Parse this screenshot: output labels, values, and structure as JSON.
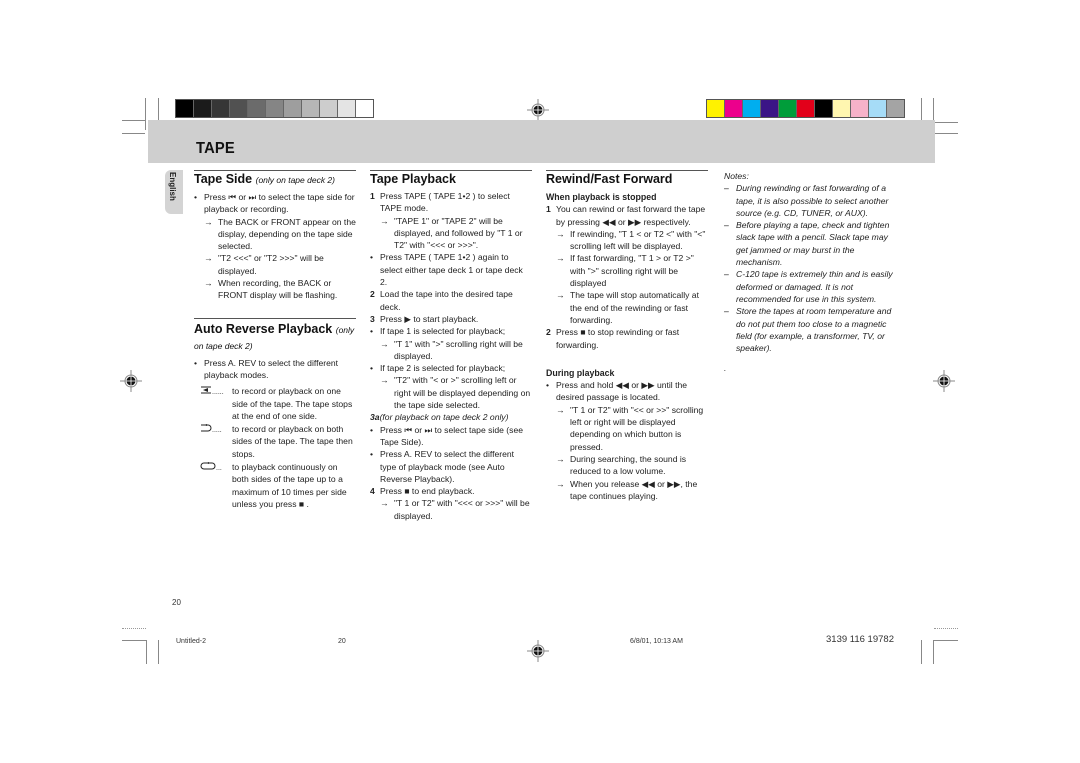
{
  "header": {
    "section_title": "TAPE",
    "language_tab": "English",
    "gray_swatches": [
      "#000000",
      "#1b1b1b",
      "#363636",
      "#515151",
      "#6b6b6b",
      "#858585",
      "#9e9e9e",
      "#b6b6b6",
      "#cdcdcd",
      "#e4e4e4",
      "#ffffff"
    ],
    "color_swatches": [
      "#fff200",
      "#ec008c",
      "#00aeef",
      "#3b1586",
      "#009d3a",
      "#e2001a",
      "#000000",
      "#fff6b0",
      "#f6b2c9",
      "#a6dcf7",
      "#a4a4a4"
    ]
  },
  "col1": {
    "tape_side": {
      "title": "Tape Side",
      "note": "(only on tape deck 2)",
      "items": [
        {
          "m": "•",
          "t": "Press ⏮ or ⏭ to select the tape side for playback or recording."
        },
        {
          "m": "→",
          "t": "The BACK or FRONT appear on the display, depending on the tape side selected.",
          "sub": true
        },
        {
          "m": "→",
          "t": "\"T2  <<<\" or \"T2  >>>\" will be displayed.",
          "sub": true
        },
        {
          "m": "→",
          "t": "When recording, the BACK or FRONT display will be flashing.",
          "sub": true
        }
      ]
    },
    "auto_reverse": {
      "title": "Auto Reverse Playback",
      "note": "(only on tape deck 2)",
      "intro": "Press A. REV to select the different playback modes.",
      "modes": [
        {
          "icon": "one-side-icon",
          "lead": "......",
          "t": "to record or playback on one side of the tape. The tape stops at the end of one side."
        },
        {
          "icon": "both-sides-icon",
          "lead": ".....",
          "t": "to record or playback on both sides of the tape. The tape then stops."
        },
        {
          "icon": "continuous-icon",
          "lead": "...",
          "t": "to playback continuously on both sides of the tape up to a maximum of 10 times per side unless you press ■ ."
        }
      ]
    }
  },
  "col2": {
    "title": "Tape Playback",
    "items": [
      {
        "m": "1",
        "t": "Press TAPE ( TAPE 1•2 ) to select TAPE mode."
      },
      {
        "m": "→",
        "t": "\"TAPE  1\" or \"TAPE  2\" will be displayed,  and followed by \"T 1  or T2\" with \"<<<  or >>>\".",
        "sub": true
      },
      {
        "m": "•",
        "t": "Press TAPE ( TAPE 1•2 ) again to select either tape deck 1 or tape deck 2."
      },
      {
        "m": "2",
        "t": "Load the tape into the desired tape deck."
      },
      {
        "m": "3",
        "t": "Press ▶ to start playback."
      },
      {
        "m": "•",
        "t": "If tape 1 is selected for playback;"
      },
      {
        "m": "→",
        "t": "\"T 1\" with \">\" scrolling right will be displayed.",
        "sub": true
      },
      {
        "m": "•",
        "t": "If tape 2 is selected for playback;"
      },
      {
        "m": "→",
        "t": "\"T2\" with \"<  or  >\" scrolling left or right will be displayed depending on the tape side selected.",
        "sub": true
      },
      {
        "m": "3a",
        "t": "(for playback on tape deck 2 only)",
        "italic": true,
        "flush": true
      },
      {
        "m": "•",
        "t": "Press ⏮ or ⏭ to select tape side (see Tape Side)."
      },
      {
        "m": "•",
        "t": "Press A. REV to select the different type of playback mode (see Auto Reverse Playback)."
      },
      {
        "m": "4",
        "t": "Press ■  to end playback."
      },
      {
        "m": "→",
        "t": "\"T 1  or  T2\" with \"<<<  or  >>>\" will be displayed.",
        "sub": true
      }
    ]
  },
  "col3": {
    "title": "Rewind/Fast Forward",
    "stopped_heading": "When playback is stopped",
    "stopped_items": [
      {
        "m": "1",
        "t": "You can rewind or fast forward the tape by pressing ◀◀ or ▶▶ respectively."
      },
      {
        "m": "→",
        "t": "If rewinding, \"T 1  <  or  T2  <\" with \"<\" scrolling left will be displayed.",
        "sub": true
      },
      {
        "m": "→",
        "t": "If fast forwarding, \"T 1  >   or T2  >\" with \">\" scrolling right will be displayed",
        "sub": true
      },
      {
        "m": "→",
        "t": "The tape will stop automatically at the end of the rewinding or fast forwarding.",
        "sub": true
      },
      {
        "m": "2",
        "t": "Press ■  to stop rewinding or fast forwarding."
      }
    ],
    "playback_heading": "During playback",
    "playback_items": [
      {
        "m": "•",
        "t": "Press and hold ◀◀ or ▶▶ until the desired passage is located."
      },
      {
        "m": "→",
        "t": "\"T 1  or  T2\" with \"<<  or  >>\" scrolling left or right will be displayed depending on which button is pressed.",
        "sub": true
      },
      {
        "m": "→",
        "t": "During searching, the sound is reduced to a low volume.",
        "sub": true
      },
      {
        "m": "→",
        "t": "When you release ◀◀ or ▶▶, the tape continues playing.",
        "sub": true
      }
    ]
  },
  "notes": {
    "title": "Notes:",
    "items": [
      "During rewinding or fast forwarding of a tape, it is also possible to select another source (e.g. CD, TUNER, or AUX).",
      "Before playing a tape, check and tighten slack tape with a pencil. Slack tape may get jammed or may burst in the mechanism.",
      "C-120 tape is extremely thin and is easily deformed or damaged.  It is not recommended for use in this system.",
      "Store the tapes at room temperature and do not put them too close to a magnetic field (for example, a transformer, TV, or speaker)."
    ],
    "trailing": "."
  },
  "footer": {
    "page_number": "20",
    "file_name": "Untitled-2",
    "file_page": "20",
    "timestamp": "6/8/01, 10:13 AM",
    "part_number": "3139 116 19782"
  }
}
